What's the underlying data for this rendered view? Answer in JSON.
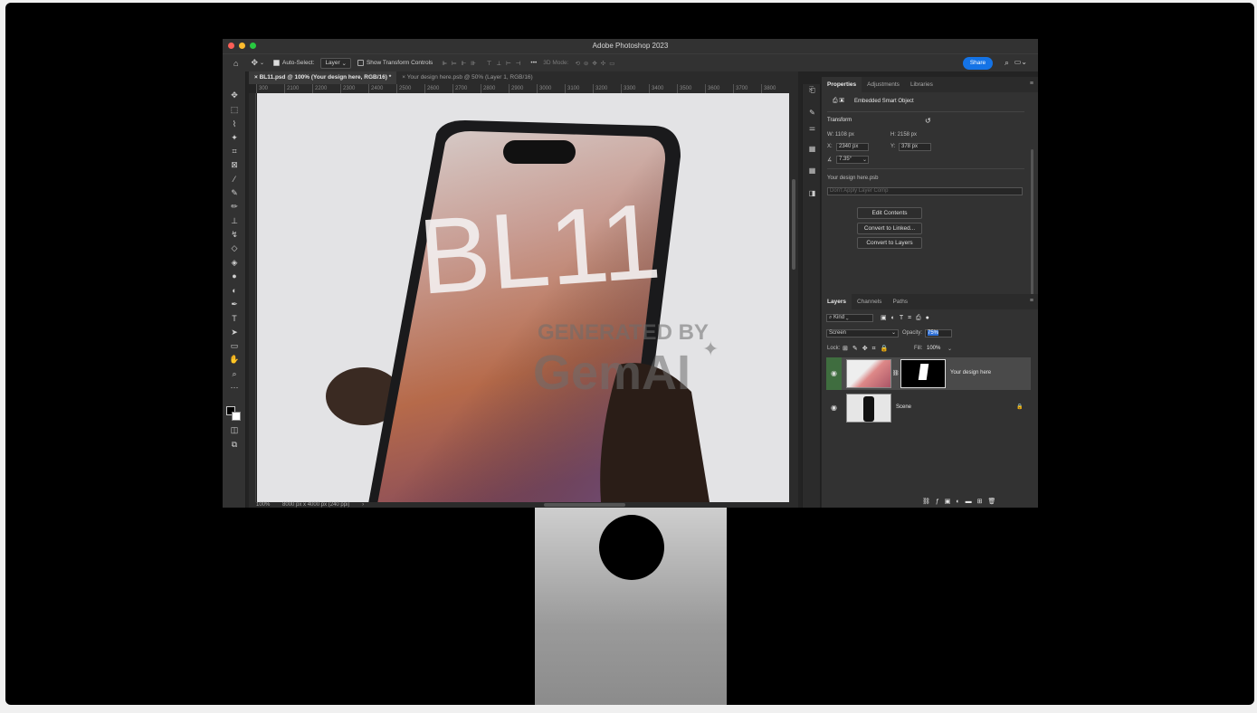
{
  "window": {
    "title": "Adobe Photoshop 2023"
  },
  "options": {
    "auto_select_label": "Auto-Select:",
    "auto_select_value": "Layer",
    "show_transform_label": "Show Transform Controls",
    "mode_3d": "3D Mode:",
    "share_label": "Share"
  },
  "tabs": [
    {
      "label": "BL11.psd @ 100% (Your design here, RGB/16) *"
    },
    {
      "label": "Your design here.psb @ 50% (Layer 1, RGB/16)"
    }
  ],
  "ruler": [
    "300",
    "2100",
    "2200",
    "2300",
    "2400",
    "2500",
    "2600",
    "2700",
    "2800",
    "2900",
    "3000",
    "3100",
    "3200",
    "3300",
    "3400",
    "3500",
    "3600",
    "3700",
    "3800"
  ],
  "canvas": {
    "phone_text": "BL11",
    "watermark_line1": "GENERATED BY",
    "watermark_line2": "GemAI"
  },
  "status": {
    "zoom": "100%",
    "doc_info": "8000 px x 4000 px (240 ppi)"
  },
  "properties": {
    "tabs": [
      "Properties",
      "Adjustments",
      "Libraries"
    ],
    "type_label": "Embedded Smart Object",
    "section_transform": "Transform",
    "w_label": "W:",
    "w_value": "1108 px",
    "h_label": "H:",
    "h_value": "2158 px",
    "x_label": "X:",
    "x_value": "2340 px",
    "y_label": "Y:",
    "y_value": "378 px",
    "angle_value": "7.35°",
    "linked_file": "Your design here.psb",
    "layer_comp": "Don't Apply Layer Comp",
    "btn_edit": "Edit Contents",
    "btn_linked": "Convert to Linked...",
    "btn_layers": "Convert to Layers"
  },
  "layers": {
    "tabs": [
      "Layers",
      "Channels",
      "Paths"
    ],
    "kind": "Kind",
    "blend_mode": "Screen",
    "opacity_label": "Opacity:",
    "opacity_value": "75%",
    "lock_label": "Lock:",
    "fill_label": "Fill:",
    "fill_value": "100%",
    "items": [
      {
        "name": "Your design here"
      },
      {
        "name": "Scene"
      }
    ]
  },
  "colors": {
    "accent": "#1473e6",
    "panel": "#323232",
    "canvas_bg": "#e3e3e5"
  }
}
